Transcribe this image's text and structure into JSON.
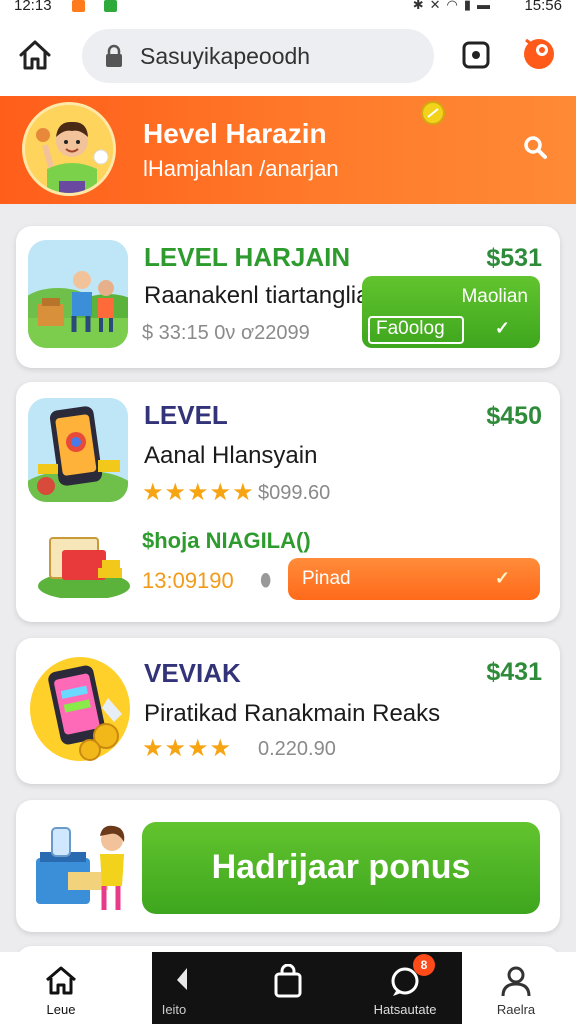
{
  "status_bar": {
    "time_left": "12:13",
    "time_right": "15:56",
    "icons": [
      "bluetooth-icon",
      "mute-icon",
      "wifi-icon",
      "signal-icon",
      "battery-icon"
    ]
  },
  "browser": {
    "url": "Sasuyikapeoodh",
    "icons": [
      "home-icon",
      "lock-icon",
      "tabs-icon",
      "profile-icon"
    ]
  },
  "header": {
    "title": "Hevel Harazin",
    "subtitle": "lHamjahlan /anarjan",
    "colors": {
      "start": "#ff5e1a",
      "end": "#ff8a35"
    }
  },
  "cards": [
    {
      "title": "LEVEL HARJAIN",
      "price": "$531",
      "subtitle": "Raanakenl tiartanglial",
      "meta": "$ 33:15 0ν  ơ22099",
      "button_top": "Maolian",
      "button_label": "Fa0olog",
      "title_color": "#2e9b2e"
    },
    {
      "title": "LEVEL",
      "price": "$450",
      "subtitle": "Aanal Hlansyain",
      "rating_value": "$099.60",
      "stars": 5,
      "promo": "$hoja NIAGILA()",
      "promo_meta": "13:09190",
      "button_label": "Pinad",
      "title_color": "#33337a"
    },
    {
      "title": "VEVIAK",
      "price": "$431",
      "subtitle": "Piratikad Ranakmain Reaks",
      "rating_value": "0.220.90",
      "stars": 4,
      "title_color": "#33337a"
    }
  ],
  "cta": {
    "label": "Hadrijaar ponus"
  },
  "bottom_nav": {
    "items": [
      {
        "label": "Leue",
        "icon": "home-icon"
      },
      {
        "label": "Ieito",
        "icon": "pin-icon"
      },
      {
        "label": "",
        "icon": "bag-icon"
      },
      {
        "label": "Hatsautate",
        "icon": "chat-icon",
        "badge": "8"
      },
      {
        "label": "Raelra",
        "icon": "person-icon"
      }
    ]
  },
  "accent_colors": {
    "orange": "#ff6a1a",
    "green": "#3ea61e",
    "price_green": "#2e8b3a"
  }
}
